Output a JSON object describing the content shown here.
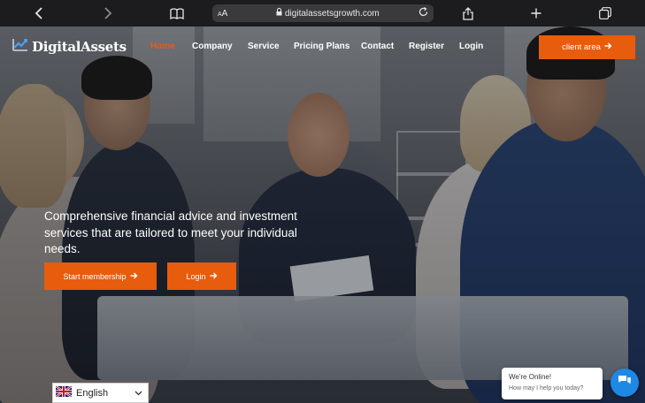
{
  "browser": {
    "url": "digitalassetsgrowth.com",
    "text_size_label": "AA",
    "icons": [
      "back-arrow",
      "forward-arrow",
      "book",
      "lock",
      "reload",
      "share",
      "plus",
      "tabs"
    ]
  },
  "site": {
    "logo_text": "DigitalAssets",
    "nav": [
      {
        "label": "Home",
        "active": true
      },
      {
        "label": "Company",
        "active": false
      },
      {
        "label": "Service",
        "active": false
      },
      {
        "label": "Pricing Plans",
        "active": false
      },
      {
        "label": "Contact",
        "active": false
      },
      {
        "label": "Register",
        "active": false
      },
      {
        "label": "Login",
        "active": false
      }
    ],
    "client_area_label": "client area"
  },
  "hero": {
    "headline": "Comprehensive financial advice and investment services that are tailored to meet your individual needs.",
    "start_membership_label": "Start membership",
    "login_label": "Login"
  },
  "language": {
    "selected": "English"
  },
  "chat": {
    "title": "We're Online!",
    "subtitle": "How may I help you today?"
  },
  "colors": {
    "accent": "#e85c0d",
    "active_nav": "#e85c1a",
    "chat_blue": "#1e88e5",
    "browser_bg": "#1c1c1e"
  }
}
